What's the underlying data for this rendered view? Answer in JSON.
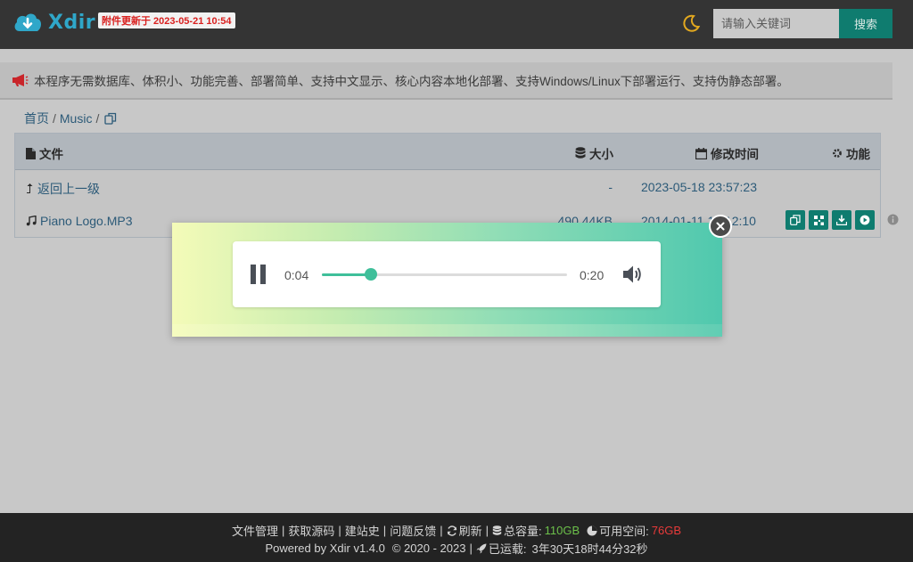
{
  "header": {
    "logo_text": "Xdir",
    "update_badge": "附件更新于 2023-05-21 10:54",
    "search_placeholder": "请输入关键词",
    "search_button": "搜索"
  },
  "notice": {
    "text": "本程序无需数据库、体积小、功能完善、部署简单、支持中文显示、核心内容本地化部署、支持Windows/Linux下部署运行、支持伪静态部署。"
  },
  "breadcrumb": {
    "home": "首页",
    "sep": "/",
    "current": "Music"
  },
  "table": {
    "headers": {
      "file": "文件",
      "size": "大小",
      "modified": "修改时间",
      "function": "功能"
    },
    "rows": [
      {
        "name": "返回上一级",
        "size": "-",
        "modified": "2023-05-18 23:57:23"
      },
      {
        "name": "Piano Logo.MP3",
        "size": "490.44KB",
        "modified": "2014-01-11 12:12:10"
      }
    ]
  },
  "player": {
    "current_time": "0:04",
    "total_time": "0:20",
    "progress": 0.2
  },
  "footer": {
    "links": [
      "文件管理",
      "获取源码",
      "建站史",
      "问题反馈"
    ],
    "refresh": "刷新",
    "total_label": "总容量:",
    "total_value": "110GB",
    "free_label": "可用空间:",
    "free_value": "76GB",
    "powered": "Powered by Xdir v1.4.0",
    "copyright": "© 2020 - 2023",
    "uptime_label": "已运载:",
    "uptime_value": "3年30天18时44分32秒"
  },
  "colors": {
    "accent": "#0f7c6f",
    "progress": "#3fbf9a",
    "badge_text": "#d9201f",
    "value_green": "#6cc04a",
    "value_red": "#e83a3a"
  },
  "icons": [
    "cloud-download-icon",
    "moon-icon",
    "megaphone-icon",
    "copy-icon",
    "file-icon",
    "database-icon",
    "calendar-icon",
    "gear-icon",
    "level-up-icon",
    "music-icon",
    "qrcode-icon",
    "download-icon",
    "play-icon",
    "info-icon",
    "close-icon",
    "pause-icon",
    "volume-icon",
    "refresh-icon",
    "pie-chart-icon",
    "rocket-icon"
  ]
}
